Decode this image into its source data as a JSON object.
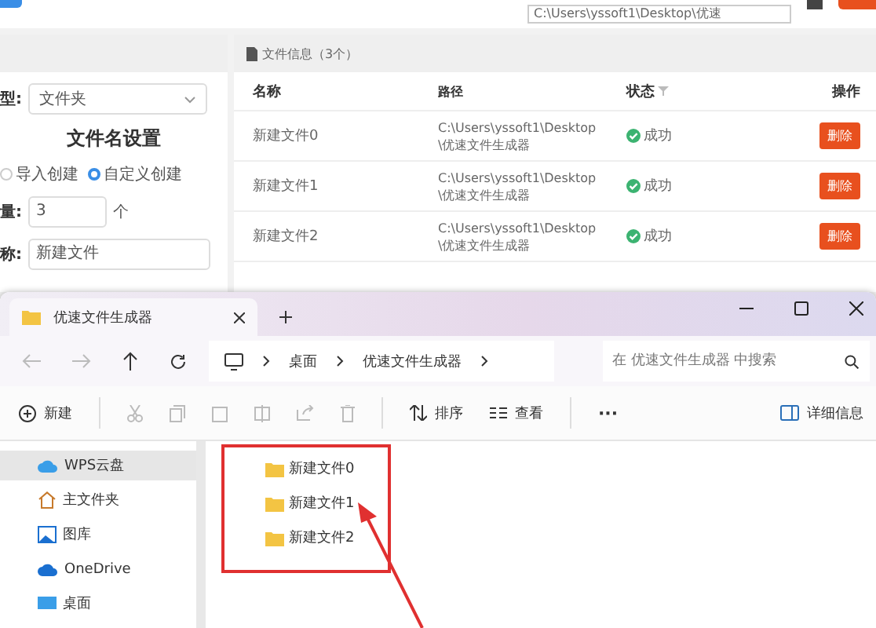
{
  "top_bar": {
    "path_value": "C:\\Users\\yssoft1\\Desktop\\优速"
  },
  "settings": {
    "type_label": "型:",
    "type_value": "文件夹",
    "section_title": "文件名设置",
    "modes": [
      {
        "label": "导入创建",
        "selected": false
      },
      {
        "label": "自定义创建",
        "selected": true
      }
    ],
    "count_label": "量:",
    "count_value": "3",
    "count_unit": "个",
    "name_label": "称:",
    "name_value": "新建文件"
  },
  "file_info": {
    "title": "文件信息（3个）",
    "columns": [
      "名称",
      "路径",
      "状态",
      "操作"
    ],
    "rows": [
      {
        "name": "新建文件0",
        "path": "C:\\Users\\yssoft1\\Desktop\\优速文件生成器",
        "status": "成功",
        "action": "删除"
      },
      {
        "name": "新建文件1",
        "path": "C:\\Users\\yssoft1\\Desktop\\优速文件生成器",
        "status": "成功",
        "action": "删除"
      },
      {
        "name": "新建文件2",
        "path": "C:\\Users\\yssoft1\\Desktop\\优速文件生成器",
        "status": "成功",
        "action": "删除"
      }
    ]
  },
  "explorer": {
    "tab_title": "优速文件生成器",
    "breadcrumb": [
      "桌面",
      "优速文件生成器"
    ],
    "search_placeholder": "在 优速文件生成器 中搜索",
    "toolbar": {
      "new": "新建",
      "sort": "排序",
      "view": "查看",
      "more": "···",
      "details": "详细信息"
    },
    "sidebar": [
      {
        "label": "WPS云盘",
        "kind": "cloud",
        "selected": true
      },
      {
        "label": "主文件夹",
        "kind": "home",
        "selected": false
      },
      {
        "label": "图库",
        "kind": "gallery",
        "selected": false
      },
      {
        "label": "OneDrive",
        "kind": "cloud",
        "selected": false
      },
      {
        "label": "桌面",
        "kind": "desktop",
        "selected": false
      }
    ],
    "files": [
      "新建文件0",
      "新建文件1",
      "新建文件2"
    ]
  }
}
